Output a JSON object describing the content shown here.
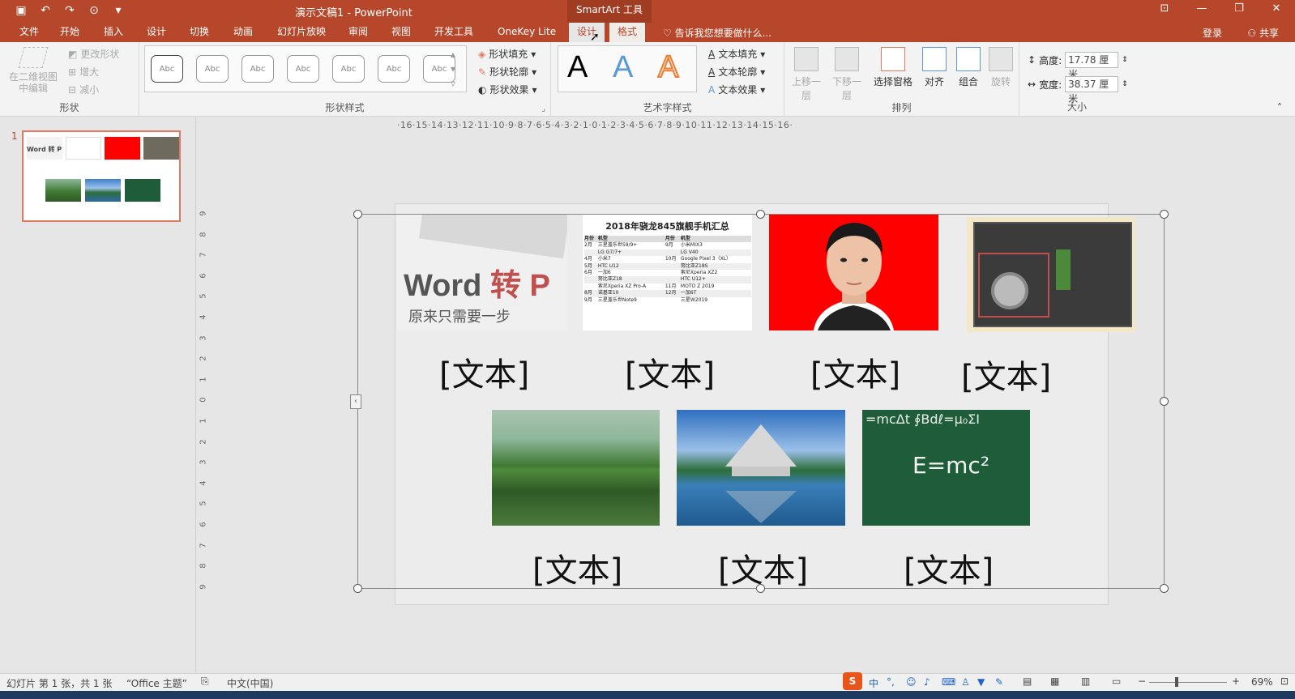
{
  "window": {
    "title": "演示文稿1 - PowerPoint",
    "contextual_tab_group": "SmartArt 工具",
    "controls": [
      "restore-icon",
      "minimize-icon",
      "maximize-icon",
      "close-icon"
    ]
  },
  "tabs": {
    "file": "文件",
    "home": "开始",
    "insert": "插入",
    "design": "设计",
    "transitions": "切换",
    "animations": "动画",
    "slideshow": "幻灯片放映",
    "review": "审阅",
    "view": "视图",
    "developer": "开发工具",
    "onekey": "OneKey Lite",
    "sa_design": "设计",
    "sa_format": "格式"
  },
  "tell_me": "告诉我您想要做什么...",
  "account": {
    "login": "登录",
    "share": "共享"
  },
  "ribbon": {
    "shapes_group": {
      "edit_2d": "在二维视图中编辑",
      "change_shape": "更改形状",
      "larger": "增大",
      "smaller": "减小",
      "label": "形状"
    },
    "shape_styles": {
      "sample": "Abc",
      "fill": "形状填充",
      "outline": "形状轮廓",
      "effects": "形状效果",
      "label": "形状样式"
    },
    "wordart": {
      "letter": "A",
      "text_fill": "文本填充",
      "text_outline": "文本轮廓",
      "text_effects": "文本效果",
      "label": "艺术字样式"
    },
    "arrange": {
      "bring_forward": "上移一层",
      "send_backward": "下移一层",
      "selection_pane": "选择窗格",
      "align": "对齐",
      "group": "组合",
      "rotate": "旋转",
      "label": "排列"
    },
    "size": {
      "height_label": "高度:",
      "height_value": "17.78 厘米",
      "width_label": "宽度:",
      "width_value": "38.37 厘米",
      "label": "大小"
    }
  },
  "thumbnail": {
    "number": "1",
    "word_text": "Word 转 P"
  },
  "ruler": {
    "horizontal": "·16·15·14·13·12·11·10·9·8·7·6·5·4·3·2·1·0·1·2·3·4·5·6·7·8·9·10·11·12·13·14·15·16·",
    "vertical": [
      "9",
      "8",
      "7",
      "6",
      "5",
      "4",
      "3",
      "2",
      "1",
      "0",
      "1",
      "2",
      "3",
      "4",
      "5",
      "6",
      "7",
      "8",
      "9"
    ]
  },
  "slide": {
    "word_card_title_a": "Word ",
    "word_card_title_b": "转 P",
    "word_card_subtitle": "原来只需要一步",
    "table_title": "2018年骁龙845旗舰手机汇总",
    "table_headers": [
      "月份",
      "机型",
      "月份",
      "机型"
    ],
    "table_rows": [
      [
        "2月",
        "三星盖乐世S9/9+",
        "9月",
        "小米MIX3"
      ],
      [
        "",
        "LG G7/7+",
        "",
        "LG V40"
      ],
      [
        "4月",
        "小米7",
        "10月",
        "Google Pixel 3（XL）"
      ],
      [
        "5月",
        "HTC U12",
        "",
        "努比亚Z18S"
      ],
      [
        "6月",
        "一加6",
        "",
        "索尼Xperia XZ2"
      ],
      [
        "",
        "努比亚Z18",
        "",
        "HTC U12+"
      ],
      [
        "",
        "索尼Xperia XZ Pro-A",
        "11月",
        "MOTO Z 2019"
      ],
      [
        "8月",
        "诺基亚10",
        "12月",
        "一加6T"
      ],
      [
        "9月",
        "三星盖乐世Note9",
        "",
        "三星W2019"
      ]
    ],
    "placeholder": "[文本]",
    "chalk_formula": "E=mc²",
    "chalk_top": "=mcΔt   ∮Bdℓ=μ₀ΣI"
  },
  "status": {
    "slide_info": "幻灯片 第 1 张，共 1 张",
    "theme": "“Office 主题”",
    "language": "中文(中国)",
    "ime": "中",
    "zoom": "69%",
    "zoom_value_pct": 69
  },
  "colors": {
    "accent": "#b7472a",
    "photo_red": "#ff0000",
    "chalkboard": "#1f5c3a"
  }
}
